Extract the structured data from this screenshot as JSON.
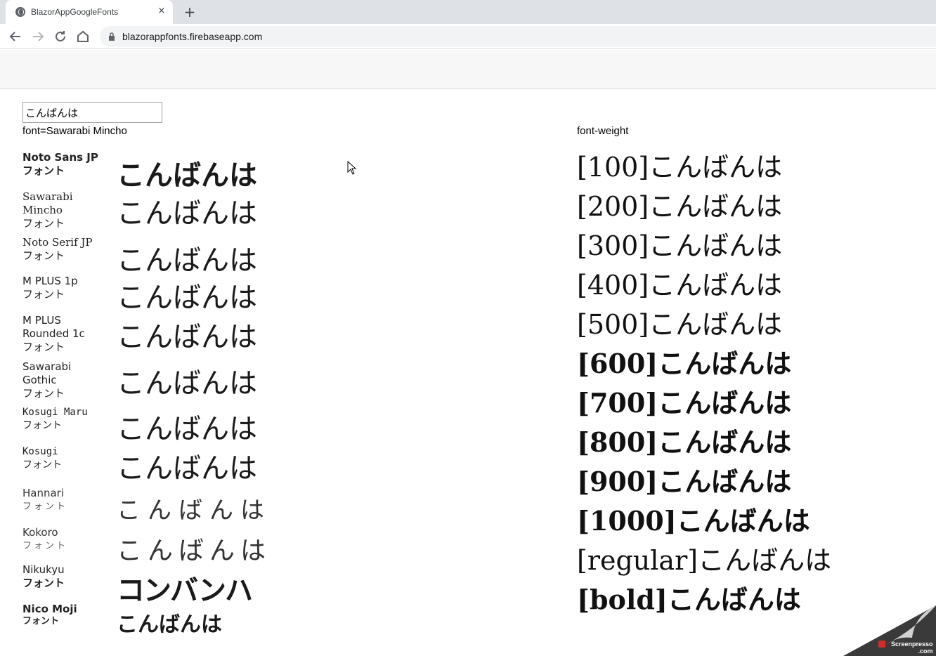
{
  "browser": {
    "tab_title": "BlazorAppGoogleFonts",
    "tab_close_glyph": "×",
    "new_tab_glyph": "+",
    "url": "blazorappfonts.firebaseapp.com"
  },
  "main": {
    "input_value": "こんばんは",
    "font_info": "font=Sawarabi Mincho",
    "weight_title": "font-weight"
  },
  "fonts": [
    {
      "name": "Noto Sans JP",
      "sub": "フォント",
      "sample": "こんばんは"
    },
    {
      "name": "Sawarabi Mincho",
      "sub": "フォント",
      "sample": "こんばんは"
    },
    {
      "name": "Noto Serif JP",
      "sub": "フォント",
      "sample": "こんばんは"
    },
    {
      "name": "M PLUS 1p",
      "sub": "フォント",
      "sample": "こんばんは"
    },
    {
      "name": "M PLUS Rounded 1c",
      "sub": "フォント",
      "sample": "こんばんは"
    },
    {
      "name": "Sawarabi Gothic",
      "sub": "フォント",
      "sample": "こんばんは"
    },
    {
      "name": "Kosugi Maru",
      "sub": "フォント",
      "sample": "こんばんは"
    },
    {
      "name": "Kosugi",
      "sub": "フォント",
      "sample": "こんばんは"
    },
    {
      "name": "Hannari",
      "sub": "フォント",
      "sample": "こんばんは"
    },
    {
      "name": "Kokoro",
      "sub": "フォント",
      "sample": "こんばんは"
    },
    {
      "name": "Nikukyu",
      "sub": "フォント",
      "sample": "コンバンハ"
    },
    {
      "name": "Nico Moji",
      "sub": "フォント",
      "sample": "こんばんは"
    }
  ],
  "weights": [
    "[100]こんばんは",
    "[200]こんばんは",
    "[300]こんばんは",
    "[400]こんばんは",
    "[500]こんばんは",
    "[600]こんばんは",
    "[700]こんばんは",
    "[800]こんばんは",
    "[900]こんばんは",
    "[1000]こんばんは",
    "[regular]こんばんは",
    "[bold]こんばんは"
  ],
  "watermark": {
    "line1": "Screenpresso",
    "line2": ".com"
  }
}
